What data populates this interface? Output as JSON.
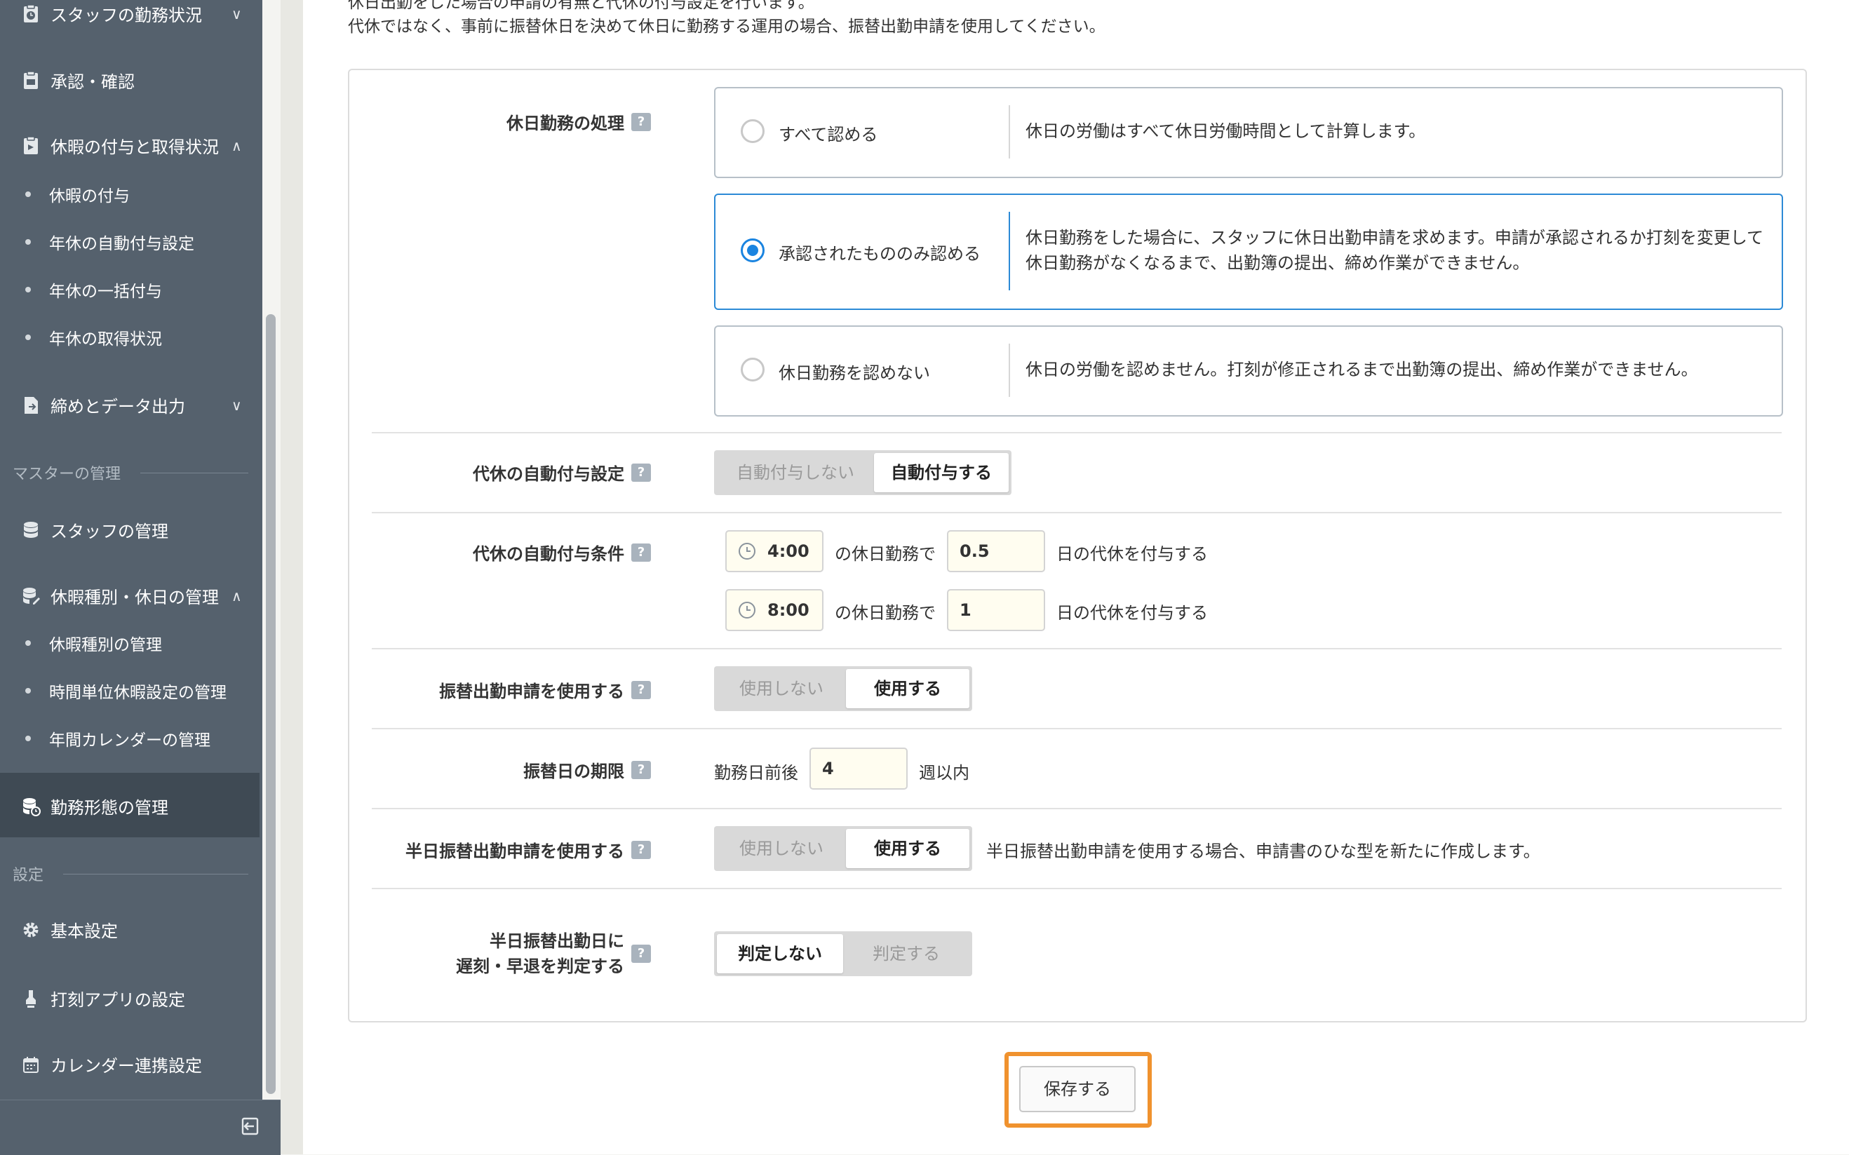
{
  "sidebar": {
    "items": [
      {
        "label": "スタッフの勤務状況",
        "icon": "clock-doc-icon",
        "chevron": "∨"
      },
      {
        "label": "承認・確認",
        "icon": "approve-doc-icon"
      },
      {
        "label": "休暇の付与と取得状況",
        "icon": "leave-doc-icon",
        "chevron": "∧"
      },
      {
        "label": "休暇の付与"
      },
      {
        "label": "年休の自動付与設定"
      },
      {
        "label": "年休の一括付与"
      },
      {
        "label": "年休の取得状況"
      },
      {
        "label": "締めとデータ出力",
        "icon": "export-doc-icon",
        "chevron": "∨"
      },
      {
        "label": "スタッフの管理",
        "icon": "database-icon"
      },
      {
        "label": "休暇種別・休日の管理",
        "icon": "database-edit-icon",
        "chevron": "∧"
      },
      {
        "label": "休暇種別の管理"
      },
      {
        "label": "時間単位休暇設定の管理"
      },
      {
        "label": "年間カレンダーの管理"
      },
      {
        "label": "勤務形態の管理",
        "icon": "database-clock-icon"
      },
      {
        "label": "基本設定",
        "icon": "gear-icon"
      },
      {
        "label": "打刻アプリの設定",
        "icon": "stamp-icon"
      },
      {
        "label": "カレンダー連携設定",
        "icon": "calendar-icon"
      }
    ],
    "sections": {
      "master": "マスターの管理",
      "settings": "設定"
    }
  },
  "notes": {
    "line1": "休日出勤をした場合の申請の有無と代休の付与設定を行います。",
    "line2": "代休ではなく、事前に振替休日を決めて休日に勤務する運用の場合、振替出勤申請を使用してください。"
  },
  "holiday_work": {
    "label": "休日勤務の処理",
    "options": [
      {
        "label": "すべて認める",
        "desc1": "休日の労働はすべて休日労働時間として計算します。",
        "desc2": "",
        "selected": false
      },
      {
        "label": "承認されたもののみ認める",
        "desc1": "休日勤務をした場合に、スタッフに休日出勤申請を求めます。申請が承認されるか打刻を変更して",
        "desc2": "休日勤務がなくなるまで、出勤簿の提出、締め作業ができません。",
        "selected": true
      },
      {
        "label": "休日勤務を認めない",
        "desc1": "休日の労働を認めません。打刻が修正されるまで出勤簿の提出、締め作業ができません。",
        "desc2": "",
        "selected": false
      }
    ]
  },
  "comp_auto": {
    "label": "代休の自動付与設定",
    "off": "自動付与しない",
    "on": "自動付与する",
    "selected": "on"
  },
  "comp_cond": {
    "label": "代休の自動付与条件",
    "rows": [
      {
        "time": "4:00",
        "mid": "の休日勤務で",
        "days": "0.5",
        "suffix": "日の代休を付与する"
      },
      {
        "time": "8:00",
        "mid": "の休日勤務で",
        "days": "1",
        "suffix": "日の代休を付与する"
      }
    ]
  },
  "substitute": {
    "label": "振替出勤申請を使用する",
    "off": "使用しない",
    "on": "使用する",
    "selected": "on"
  },
  "sub_deadline": {
    "label": "振替日の期限",
    "prefix": "勤務日前後",
    "value": "4",
    "suffix": "週以内"
  },
  "half_sub": {
    "label": "半日振替出勤申請を使用する",
    "off": "使用しない",
    "on": "使用する",
    "selected": "on",
    "note": "半日振替出勤申請を使用する場合、申請書のひな型を新たに作成します。"
  },
  "half_judge": {
    "label1": "半日振替出勤日に",
    "label2": "遅刻・早退を判定する",
    "off": "判定しない",
    "on": "判定する",
    "selected": "off"
  },
  "help_glyph": "?",
  "save": "保存する",
  "colors": {
    "sidebar": "#55616d",
    "active": "#3f4a54",
    "accent": "#1a84e0",
    "highlight": "#f0922e"
  }
}
